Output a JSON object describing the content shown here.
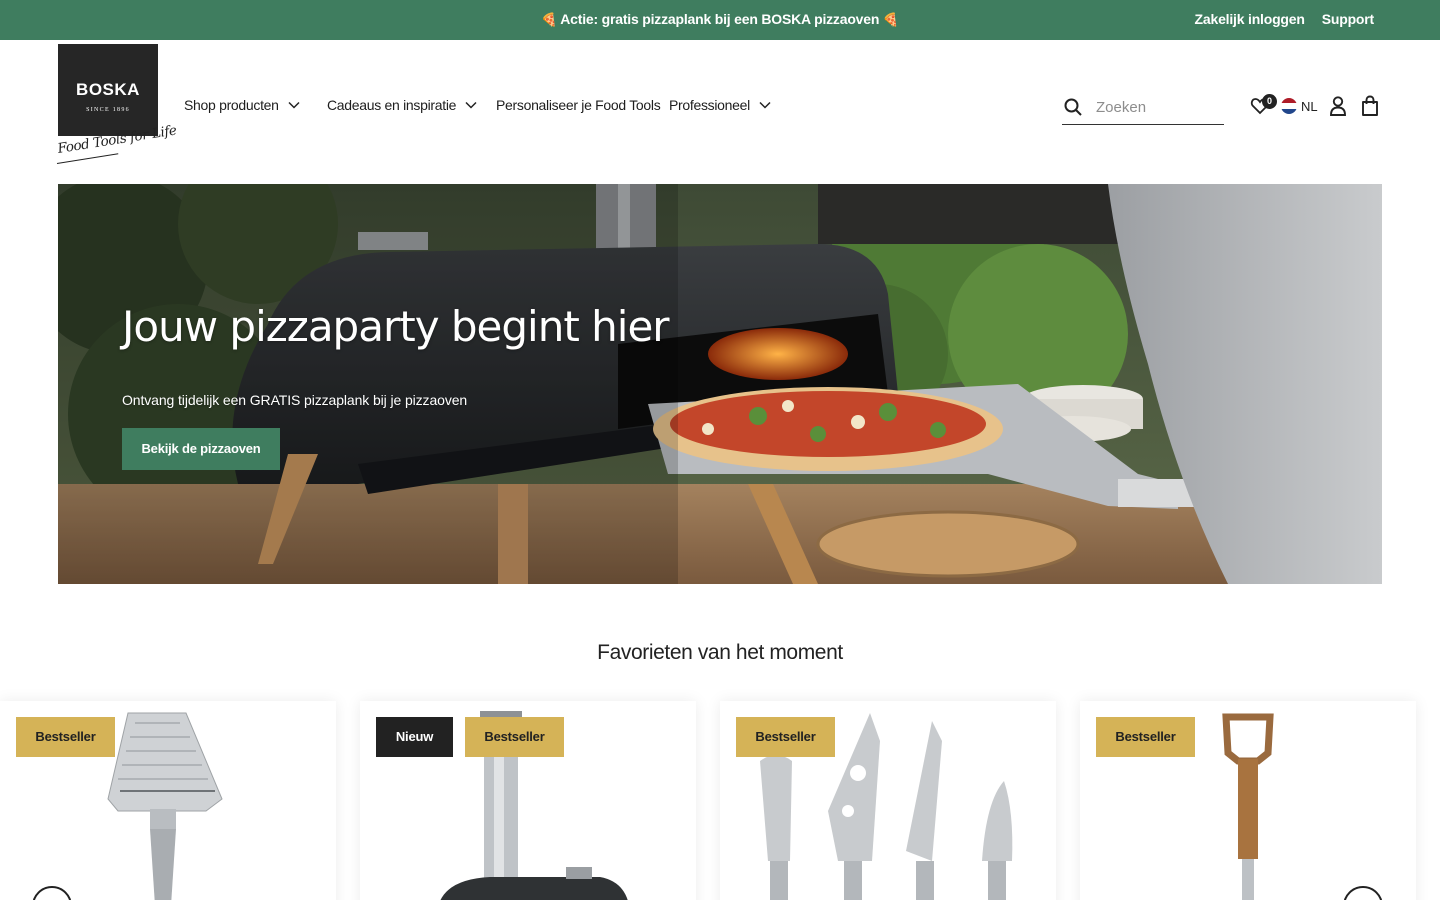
{
  "topbar": {
    "promo_text": "Actie: gratis pizzaplank bij een BOSKA pizzaoven",
    "promo_emoji": "🍕",
    "links": [
      "Zakelijk inloggen",
      "Support"
    ]
  },
  "header": {
    "logo_brand": "BOSKA",
    "logo_since": "SINCE 1896",
    "tagline": "Food Tools for Life",
    "nav": [
      {
        "label": "Shop producten"
      },
      {
        "label": "Cadeaus en inspiratie"
      },
      {
        "label": "Personaliseer je Food Tools"
      },
      {
        "label": "Professioneel"
      }
    ],
    "search_placeholder": "Zoeken",
    "wishlist_count": "0",
    "language": "NL"
  },
  "hero": {
    "title": "Jouw pizzaparty begint hier",
    "subtitle": "Ontvang tijdelijk een GRATIS pizzaplank bij je pizzaoven",
    "cta": "Bekijk de pizzaoven"
  },
  "favorites": {
    "title": "Favorieten van het moment",
    "cards": [
      {
        "tags": [
          "Bestseller"
        ],
        "product_icon": "cheese-slicer"
      },
      {
        "tags": [
          "Nieuw",
          "Bestseller"
        ],
        "product_icon": "pizza-oven"
      },
      {
        "tags": [
          "Bestseller"
        ],
        "product_icon": "cheese-knife-set"
      },
      {
        "tags": [
          "Bestseller"
        ],
        "product_icon": "garden-fork"
      }
    ]
  },
  "colors": {
    "brand_green": "#3f7d5f",
    "badge_gold": "#d5b357",
    "badge_black": "#222222"
  }
}
